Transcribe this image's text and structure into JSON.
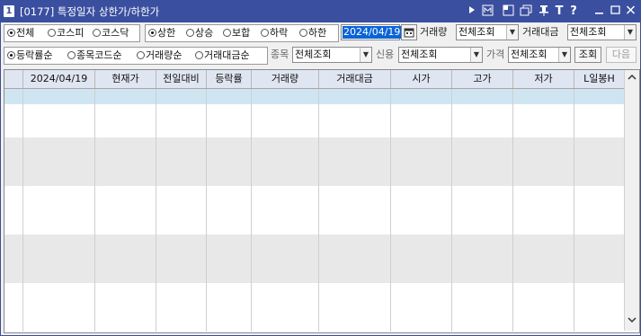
{
  "window": {
    "number": "1",
    "title": "[0177] 특정일자 상한가/하한가"
  },
  "market_filter": {
    "options": [
      {
        "label": "전체",
        "selected": true
      },
      {
        "label": "코스피",
        "selected": false
      },
      {
        "label": "코스닥",
        "selected": false
      }
    ]
  },
  "price_filter": {
    "options": [
      {
        "label": "상한",
        "selected": true
      },
      {
        "label": "상승",
        "selected": false
      },
      {
        "label": "보합",
        "selected": false
      },
      {
        "label": "하락",
        "selected": false
      },
      {
        "label": "하한",
        "selected": false
      }
    ]
  },
  "date": {
    "value": "2024/04/19"
  },
  "volume_filter": {
    "label": "거래량",
    "value": "전체조회"
  },
  "amount_filter": {
    "label": "거래대금",
    "value": "전체조회"
  },
  "sort_filter": {
    "options": [
      {
        "label": "등락률순",
        "selected": true
      },
      {
        "label": "종목코드순",
        "selected": false
      },
      {
        "label": "거래량순",
        "selected": false
      },
      {
        "label": "거래대금순",
        "selected": false
      }
    ]
  },
  "stock_filter": {
    "label": "종목",
    "value": "전체조회"
  },
  "credit_filter": {
    "label": "신용",
    "value": "전체조회"
  },
  "price_range_filter": {
    "label": "가격",
    "value": "전체조회"
  },
  "buttons": {
    "query": "조회",
    "next": "다음"
  },
  "grid": {
    "columns": [
      "",
      "2024/04/19",
      "현재가",
      "전일대비",
      "등락률",
      "거래량",
      "거래대금",
      "시가",
      "고가",
      "저가",
      "L일봉H"
    ]
  }
}
